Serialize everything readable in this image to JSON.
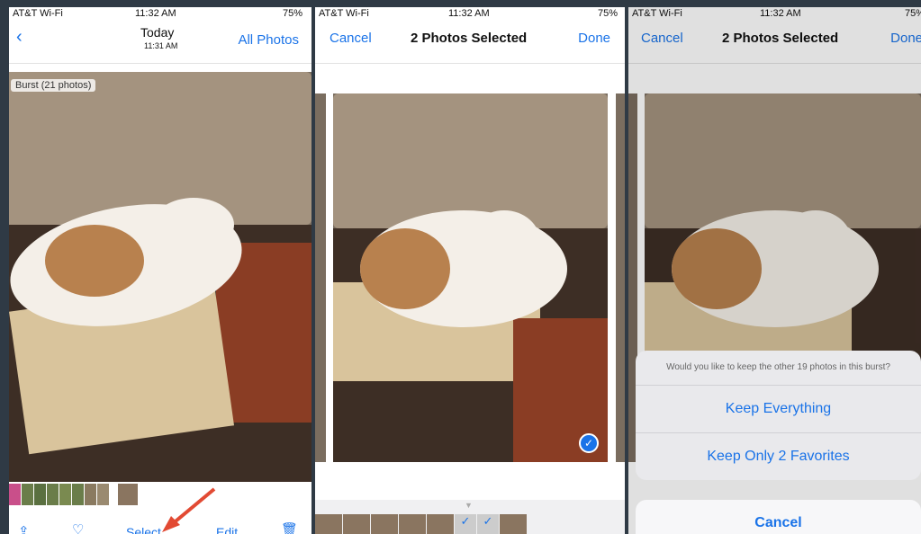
{
  "panel1": {
    "status": {
      "carrier": "AT&T Wi-Fi",
      "time": "11:32 AM",
      "battery": "75%"
    },
    "nav": {
      "back_icon": "chevron-left-icon",
      "title": "Today",
      "subtitle": "11:31 AM",
      "right": "All Photos"
    },
    "burst_badge": "Burst (21 photos)",
    "toolbar": {
      "share_icon": "share-icon",
      "heart_icon": "heart-icon",
      "select": "Select",
      "edit": "Edit",
      "trash_icon": "trash-icon"
    }
  },
  "panel2": {
    "status": {
      "carrier": "AT&T Wi-Fi",
      "time": "11:32 AM",
      "battery": "75%"
    },
    "nav": {
      "cancel": "Cancel",
      "title": "2 Photos Selected",
      "done": "Done"
    }
  },
  "panel3": {
    "status": {
      "carrier": "AT&T Wi-Fi",
      "time": "11:32 AM",
      "battery": "75%"
    },
    "nav": {
      "cancel": "Cancel",
      "title": "2 Photos Selected",
      "done": "Done"
    },
    "sheet": {
      "message": "Would you like to keep the other 19 photos in this burst?",
      "keep_everything": "Keep Everything",
      "keep_favorites": "Keep Only 2 Favorites",
      "cancel": "Cancel"
    }
  },
  "colors": {
    "accent": "#1a73e8",
    "annotation_arrow": "#e24a33"
  }
}
